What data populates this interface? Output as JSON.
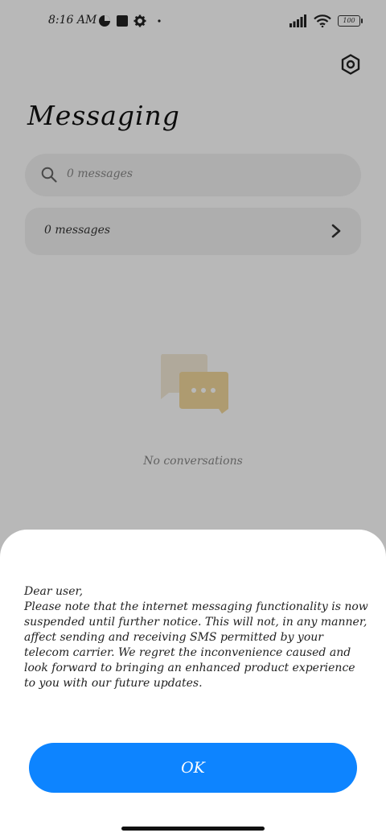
{
  "status_bar": {
    "time": "8:16 AM",
    "battery_level": "100"
  },
  "header": {
    "title": "Messaging",
    "settings_icon": "gear-icon"
  },
  "search": {
    "placeholder": "0 messages"
  },
  "messages_row": {
    "label": "0 messages"
  },
  "empty_state": {
    "text": "No conversations"
  },
  "dialog": {
    "message": "Dear user,\nPlease note that the internet messaging functionality is now suspended until further notice. This will not, in any manner, affect sending and receiving SMS permitted by your telecom carrier. We regret the inconvenience caused and look forward to bringing an enhanced product experience to you with our future updates.",
    "ok_label": "OK"
  },
  "colors": {
    "accent": "#0d84ff",
    "illustration_back": "#f4ead7",
    "illustration_front": "#f1d79b"
  }
}
